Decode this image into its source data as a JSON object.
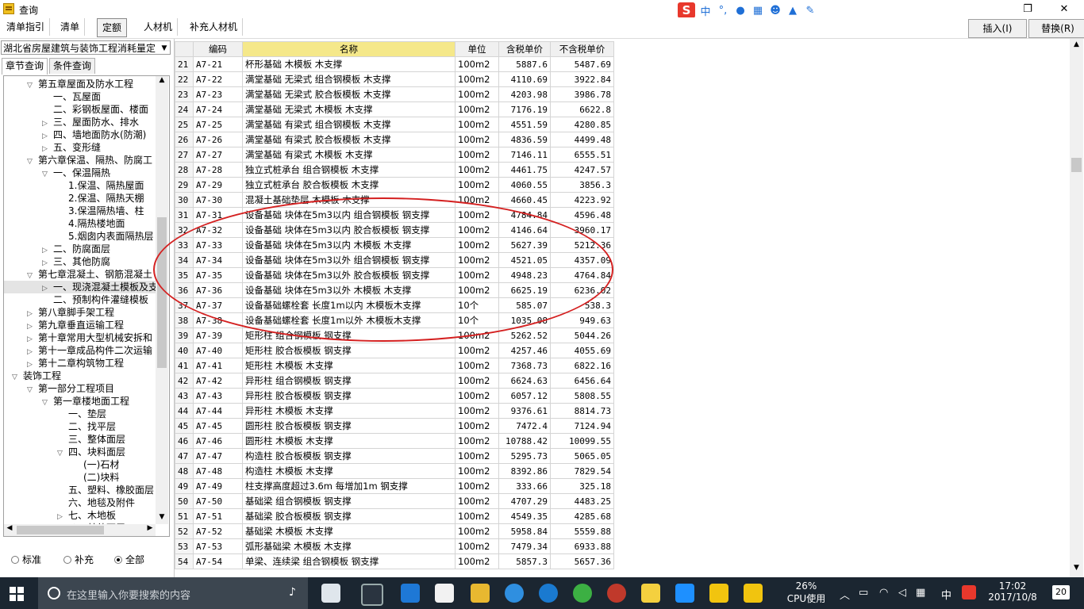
{
  "window": {
    "title": "查询"
  },
  "ime": {
    "logo": "S",
    "lang": "中",
    "punct": "°,"
  },
  "toolbar": {
    "tabs": [
      "清单指引",
      "清单",
      "定额",
      "人材机",
      "补充人材机"
    ],
    "active": "定额",
    "insert_label": "插入(I)",
    "replace_label": "替换(R)"
  },
  "left": {
    "library": "湖北省房屋建筑与装饰工程消耗量定",
    "tabs": [
      "章节查询",
      "条件查询"
    ],
    "tree": [
      {
        "label": "第五章屋面及防水工程",
        "level": 1,
        "exp": "v"
      },
      {
        "label": "一、瓦屋面",
        "level": 2,
        "exp": ""
      },
      {
        "label": "二、彩钢板屋面、楼面",
        "level": 2,
        "exp": ""
      },
      {
        "label": "三、屋面防水、排水",
        "level": 2,
        "exp": ">"
      },
      {
        "label": "四、墙地面防水(防潮)",
        "level": 2,
        "exp": ">"
      },
      {
        "label": "五、变形缝",
        "level": 2,
        "exp": ">"
      },
      {
        "label": "第六章保温、隔热、防腐工",
        "level": 1,
        "exp": "v"
      },
      {
        "label": "一、保温隔热",
        "level": 2,
        "exp": "v"
      },
      {
        "label": "1.保温、隔热屋面",
        "level": 3,
        "exp": ""
      },
      {
        "label": "2.保温、隔热天棚",
        "level": 3,
        "exp": ""
      },
      {
        "label": "3.保温隔热墙、柱",
        "level": 3,
        "exp": ""
      },
      {
        "label": "4.隔热楼地面",
        "level": 3,
        "exp": ""
      },
      {
        "label": "5.烟囱内表面隔热层",
        "level": 3,
        "exp": ""
      },
      {
        "label": "二、防腐面层",
        "level": 2,
        "exp": ">"
      },
      {
        "label": "三、其他防腐",
        "level": 2,
        "exp": ">"
      },
      {
        "label": "第七章混凝土、钢筋混凝土",
        "level": 1,
        "exp": "v"
      },
      {
        "label": "一、现浇混凝土模板及支",
        "level": 2,
        "exp": ">",
        "sel": true
      },
      {
        "label": "二、预制构件灌缝模板",
        "level": 2,
        "exp": ""
      },
      {
        "label": "第八章脚手架工程",
        "level": 1,
        "exp": ">"
      },
      {
        "label": "第九章垂直运输工程",
        "level": 1,
        "exp": ">"
      },
      {
        "label": "第十章常用大型机械安拆和",
        "level": 1,
        "exp": ">"
      },
      {
        "label": "第十一章成品构件二次运输",
        "level": 1,
        "exp": ">"
      },
      {
        "label": "第十二章构筑物工程",
        "level": 1,
        "exp": ">"
      },
      {
        "label": "装饰工程",
        "level": 0,
        "exp": "v"
      },
      {
        "label": "第一部分工程项目",
        "level": 1,
        "exp": "v"
      },
      {
        "label": "第一章楼地面工程",
        "level": 2,
        "exp": "v"
      },
      {
        "label": "一、垫层",
        "level": 3,
        "exp": ""
      },
      {
        "label": "二、找平层",
        "level": 3,
        "exp": ""
      },
      {
        "label": "三、整体面层",
        "level": 3,
        "exp": ""
      },
      {
        "label": "四、块料面层",
        "level": 3,
        "exp": "v"
      },
      {
        "label": "(一)石材",
        "level": 4,
        "exp": ""
      },
      {
        "label": "(二)块料",
        "level": 4,
        "exp": ""
      },
      {
        "label": "五、塑料、橡胶面层",
        "level": 3,
        "exp": ""
      },
      {
        "label": "六、地毯及附件",
        "level": 3,
        "exp": ""
      },
      {
        "label": "七、木地板",
        "level": 3,
        "exp": ">"
      },
      {
        "label": "八、其他面层",
        "level": 3,
        "exp": ">"
      }
    ],
    "radios": [
      {
        "label": "标准",
        "checked": false
      },
      {
        "label": "补充",
        "checked": false
      },
      {
        "label": "全部",
        "checked": true
      }
    ]
  },
  "grid": {
    "headers": [
      "编码",
      "名称",
      "单位",
      "含税单价",
      "不含税单价"
    ],
    "rows": [
      [
        "21",
        "A7-21",
        "杯形基础 木模板 木支撑",
        "100m2",
        "5887.6",
        "5487.69"
      ],
      [
        "22",
        "A7-22",
        "满堂基础 无梁式 组合钢模板 木支撑",
        "100m2",
        "4110.69",
        "3922.84"
      ],
      [
        "23",
        "A7-23",
        "满堂基础 无梁式 胶合板模板 木支撑",
        "100m2",
        "4203.98",
        "3986.78"
      ],
      [
        "24",
        "A7-24",
        "满堂基础 无梁式 木模板 木支撑",
        "100m2",
        "7176.19",
        "6622.8"
      ],
      [
        "25",
        "A7-25",
        "满堂基础 有梁式 组合钢模板 木支撑",
        "100m2",
        "4551.59",
        "4280.85"
      ],
      [
        "26",
        "A7-26",
        "满堂基础 有梁式 胶合板模板 木支撑",
        "100m2",
        "4836.59",
        "4499.48"
      ],
      [
        "27",
        "A7-27",
        "满堂基础 有梁式 木模板 木支撑",
        "100m2",
        "7146.11",
        "6555.51"
      ],
      [
        "28",
        "A7-28",
        "独立式桩承台 组合钢模板 木支撑",
        "100m2",
        "4461.75",
        "4247.57"
      ],
      [
        "29",
        "A7-29",
        "独立式桩承台 胶合板模板 木支撑",
        "100m2",
        "4060.55",
        "3856.3"
      ],
      [
        "30",
        "A7-30",
        "混凝土基础垫层 木模板 木支撑",
        "100m2",
        "4660.45",
        "4223.92"
      ],
      [
        "31",
        "A7-31",
        "设备基础 块体在5m3以内 组合钢模板 钢支撑",
        "100m2",
        "4784.84",
        "4596.48"
      ],
      [
        "32",
        "A7-32",
        "设备基础 块体在5m3以内 胶合板模板 钢支撑",
        "100m2",
        "4146.64",
        "3960.17"
      ],
      [
        "33",
        "A7-33",
        "设备基础 块体在5m3以内 木模板 木支撑",
        "100m2",
        "5627.39",
        "5212.36"
      ],
      [
        "34",
        "A7-34",
        "设备基础 块体在5m3以外 组合钢模板 钢支撑",
        "100m2",
        "4521.05",
        "4357.09"
      ],
      [
        "35",
        "A7-35",
        "设备基础 块体在5m3以外 胶合板模板 钢支撑",
        "100m2",
        "4948.23",
        "4764.84"
      ],
      [
        "36",
        "A7-36",
        "设备基础 块体在5m3以外 木模板 木支撑",
        "100m2",
        "6625.19",
        "6236.02"
      ],
      [
        "37",
        "A7-37",
        "设备基础螺栓套 长度1m以内 木模板木支撑",
        "10个",
        "585.07",
        "538.3"
      ],
      [
        "38",
        "A7-38",
        "设备基础螺栓套 长度1m以外 木模板木支撑",
        "10个",
        "1035.08",
        "949.63"
      ],
      [
        "39",
        "A7-39",
        "矩形柱 组合钢模板 钢支撑",
        "100m2",
        "5262.52",
        "5044.26"
      ],
      [
        "40",
        "A7-40",
        "矩形柱 胶合板模板 钢支撑",
        "100m2",
        "4257.46",
        "4055.69"
      ],
      [
        "41",
        "A7-41",
        "矩形柱 木模板 木支撑",
        "100m2",
        "7368.73",
        "6822.16"
      ],
      [
        "42",
        "A7-42",
        "异形柱 组合钢模板 钢支撑",
        "100m2",
        "6624.63",
        "6456.64"
      ],
      [
        "43",
        "A7-43",
        "异形柱 胶合板模板 钢支撑",
        "100m2",
        "6057.12",
        "5808.55"
      ],
      [
        "44",
        "A7-44",
        "异形柱 木模板 木支撑",
        "100m2",
        "9376.61",
        "8814.73"
      ],
      [
        "45",
        "A7-45",
        "圆形柱 胶合板模板 钢支撑",
        "100m2",
        "7472.4",
        "7124.94"
      ],
      [
        "46",
        "A7-46",
        "圆形柱 木模板 木支撑",
        "100m2",
        "10788.42",
        "10099.55"
      ],
      [
        "47",
        "A7-47",
        "构造柱 胶合板模板 钢支撑",
        "100m2",
        "5295.73",
        "5065.05"
      ],
      [
        "48",
        "A7-48",
        "构造柱 木模板 木支撑",
        "100m2",
        "8392.86",
        "7829.54"
      ],
      [
        "49",
        "A7-49",
        "柱支撑高度超过3.6m 每增加1m 钢支撑",
        "100m2",
        "333.66",
        "325.18"
      ],
      [
        "50",
        "A7-50",
        "基础梁 组合钢模板 钢支撑",
        "100m2",
        "4707.29",
        "4483.25"
      ],
      [
        "51",
        "A7-51",
        "基础梁 胶合板模板 钢支撑",
        "100m2",
        "4549.35",
        "4285.68"
      ],
      [
        "52",
        "A7-52",
        "基础梁 木模板 木支撑",
        "100m2",
        "5958.84",
        "5559.88"
      ],
      [
        "53",
        "A7-53",
        "弧形基础梁 木模板 木支撑",
        "100m2",
        "7479.34",
        "6933.88"
      ],
      [
        "54",
        "A7-54",
        "单梁、连续梁 组合钢模板 钢支撑",
        "100m2",
        "5857.3",
        "5657.36"
      ]
    ]
  },
  "taskbar": {
    "search_placeholder": "在这里输入你要搜索的内容",
    "cpu_pct": "26%",
    "cpu_label": "CPU使用",
    "lang": "中",
    "time": "17:02",
    "date": "2017/10/8",
    "notif": "20"
  },
  "colors": {
    "header_highlight": "#f5e88a",
    "annotation": "#d42020",
    "taskbar": "#1b2631"
  }
}
